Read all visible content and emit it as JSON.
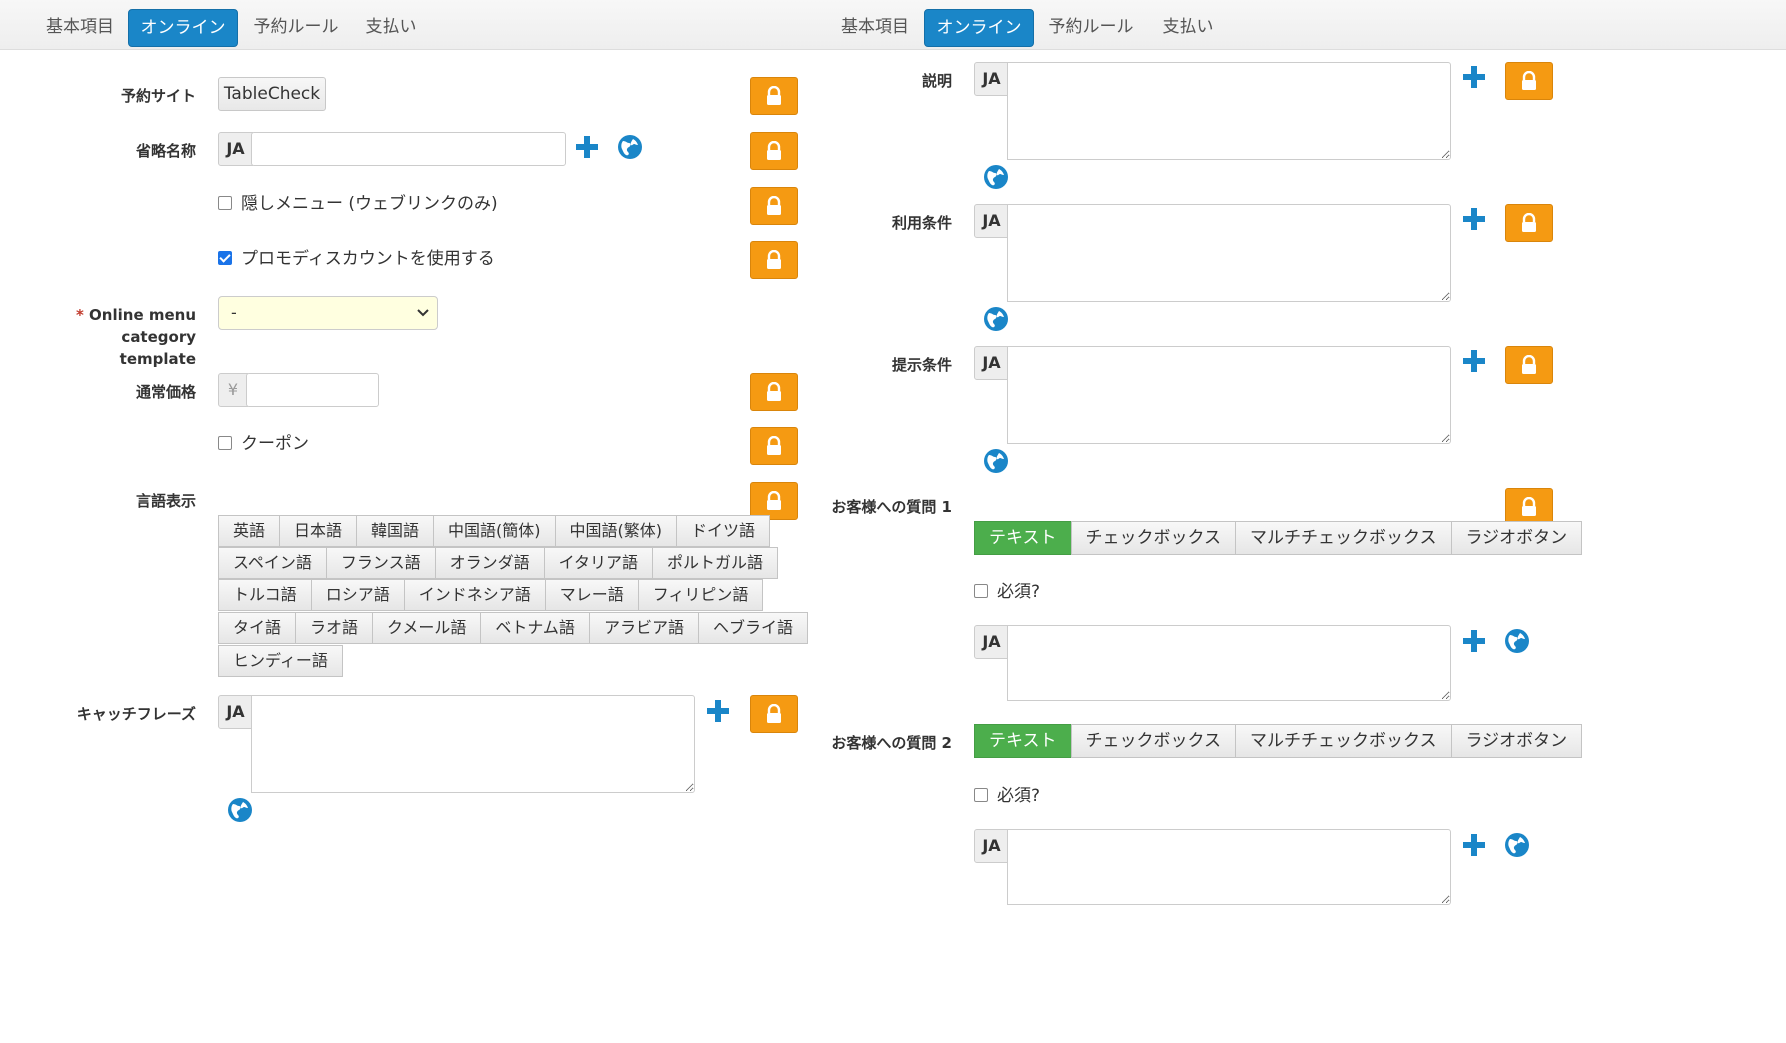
{
  "tabs": {
    "basic": "基本項目",
    "online": "オンライン",
    "rules": "予約ルール",
    "payment": "支払い"
  },
  "left": {
    "booking_site_label": "予約サイト",
    "booking_site_value": "TableCheck",
    "short_name_label": "省略名称",
    "lang_code": "JA",
    "hidden_menu_label": "隠しメニュー (ウェブリンクのみ)",
    "promo_label": "プロモディスカウントを使用する",
    "promo_checked": true,
    "category_required": "*",
    "category_label_1": "Online menu category",
    "category_label_2": "template",
    "category_value": "-",
    "price_label": "通常価格",
    "currency": "¥",
    "coupon_label": "クーポン",
    "language_label": "言語表示",
    "languages": [
      [
        "英語",
        "日本語",
        "韓国語",
        "中国語(簡体)",
        "中国語(繁体)",
        "ドイツ語"
      ],
      [
        "スペイン語",
        "フランス語",
        "オランダ語",
        "イタリア語",
        "ポルトガル語"
      ],
      [
        "トルコ語",
        "ロシア語",
        "インドネシア語",
        "マレー語",
        "フィリピン語"
      ],
      [
        "タイ語",
        "ラオ語",
        "クメール語",
        "ベトナム語",
        "アラビア語",
        "ヘブライ語"
      ],
      [
        "ヒンディー語"
      ]
    ],
    "catchphrase_label": "キャッチフレーズ"
  },
  "right": {
    "description_label": "説明",
    "terms_label": "利用条件",
    "conditions_label": "提示条件",
    "question1_label": "お客様への質問 1",
    "question2_label": "お客様への質問 2",
    "question_types": [
      "テキスト",
      "チェックボックス",
      "マルチチェックボックス",
      "ラジオボタン"
    ],
    "required_label": "必須?",
    "lang_code": "JA"
  },
  "colors": {
    "tab_active": "#1a86c8",
    "lock": "#f59a12",
    "plus": "#1a86c8",
    "segment_active": "#4cae4c"
  }
}
